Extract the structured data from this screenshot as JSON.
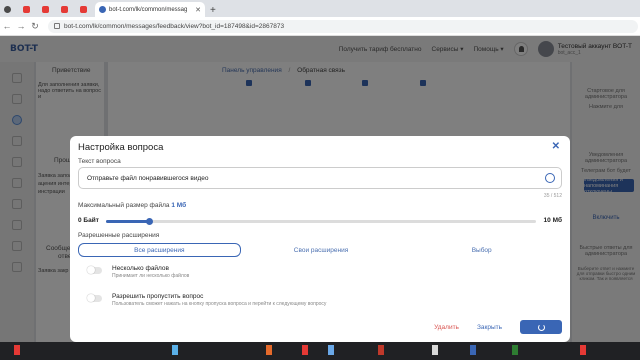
{
  "browser": {
    "tabs": [
      {
        "kind": "small",
        "color": "#4a4a4a"
      },
      {
        "kind": "small",
        "color": "#e53935"
      },
      {
        "kind": "small",
        "color": "#e53935"
      },
      {
        "kind": "small",
        "color": "#e53935"
      },
      {
        "kind": "small",
        "color": "#e53935"
      }
    ],
    "active_tab": "bot-t.com/lk/common/messag",
    "url": "bot-t.com/lk/common/messages/feedback/view?bot_id=187498&id=2867873"
  },
  "header": {
    "logo": "BOT-T",
    "links": [
      "Получить тариф бесплатно",
      "Сервисы ▾",
      "Помощь ▾"
    ],
    "account_name": "Тестовый аккаунт BOT-T",
    "account_sub": "bot_acc_1"
  },
  "background": {
    "left_col": [
      "Приветствие",
      "Для заполнения заявки, надо ответить на вопрос и",
      "Прош",
      "Заявка запол",
      "ацения интерн",
      "инстрации",
      "Сообще",
      "отве",
      "Заявка закр"
    ],
    "breadcrumb_home": "Панель управления",
    "breadcrumb_sep": "/",
    "breadcrumb_current": "Обратная связь",
    "right_col": [
      "Стартовое для администратора",
      "Нажмите для",
      "Уведомления администратора",
      "Телеграм бот будет",
      "Уведомления и напоминания отключены",
      "Включить",
      "Быстрые ответы для администратора",
      "Выберите ответ и нажмите для отправки быстро одним кликом. Так и появляется"
    ]
  },
  "modal": {
    "title": "Настройка вопроса",
    "question_label": "Текст вопроса",
    "question_value": "Отправьте файл понравившегося видео",
    "counter": "35 / 512",
    "size_label": "Максимальный размер файла",
    "size_value": "1 Мб",
    "slider_min": "0 Байт",
    "slider_max": "10 Мб",
    "slider_fraction": 0.1,
    "ext_label": "Разрешенные расширения",
    "ext_options": [
      "Все расширения",
      "Свои расширения",
      "Выбор"
    ],
    "ext_selected": 0,
    "toggles": [
      {
        "title": "Несколько файлов",
        "desc": "Принимает ли несколько файлов",
        "on": false
      },
      {
        "title": "Разрешить пропустить вопрос",
        "desc": "Пользователь сможет нажать на кнопку пропуска вопроса и перейти к следующему вопросу",
        "on": false
      }
    ],
    "btn_delete": "Удалить",
    "btn_close": "Закрыть"
  },
  "colors": {
    "accent": "#3a66b5",
    "danger": "#d9534f"
  }
}
